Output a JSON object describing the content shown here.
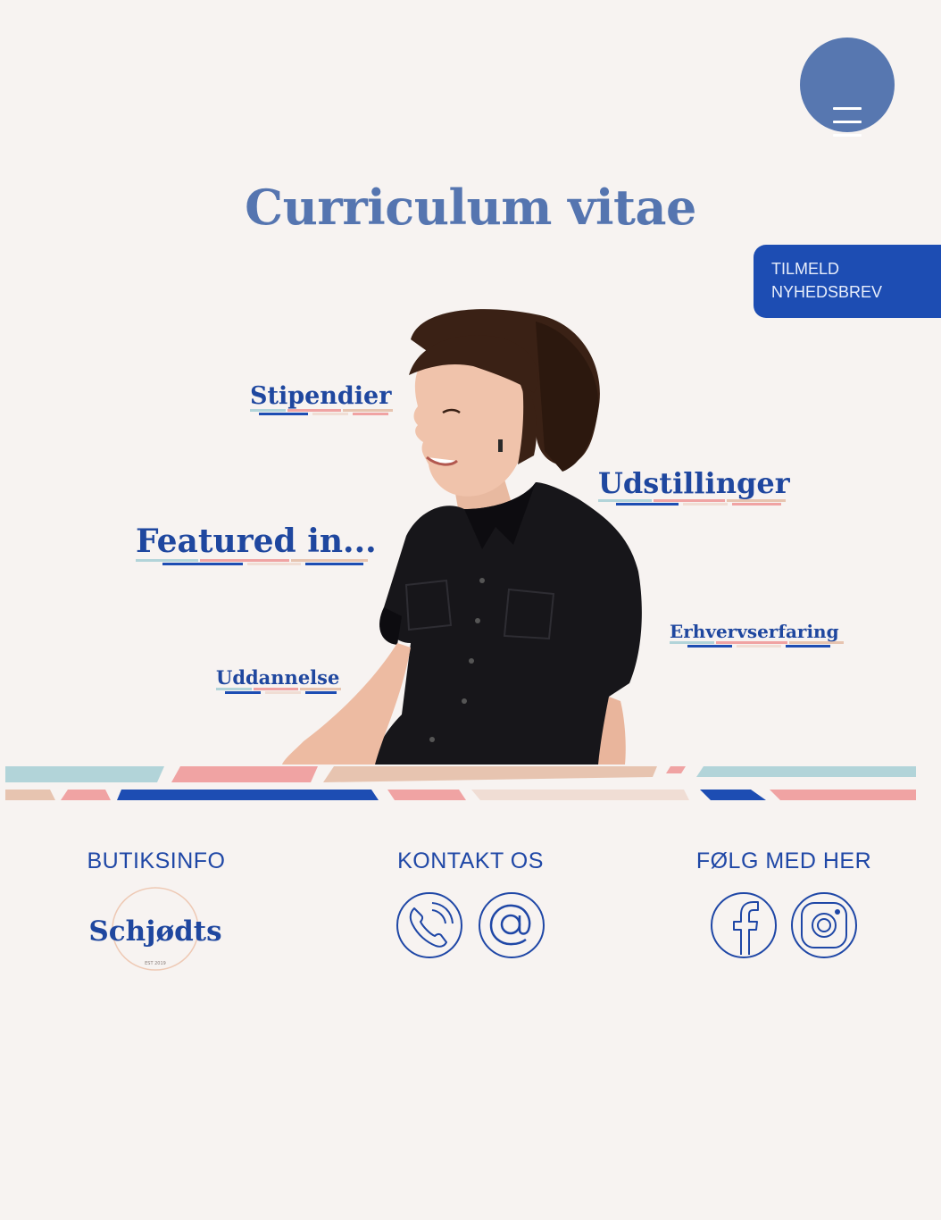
{
  "header": {
    "menu_icon": "hamburger-menu-icon",
    "title": "Curriculum vitae",
    "newsletter": {
      "line1": "TILMELD",
      "line2": "NYHEDSBREV"
    }
  },
  "hero": {
    "image": "portrait-photo",
    "links": {
      "stipendier": "Stipendier",
      "udstillinger": "Udstillinger",
      "featured": "Featured in...",
      "erhvervserfaring": "Erhvervserfaring",
      "uddannelse": "Uddannelse"
    }
  },
  "footer": {
    "butiksinfo": {
      "title": "BUTIKSINFO",
      "logo_text": "Schjødts",
      "logo_sub": "EST 2019"
    },
    "kontakt": {
      "title": "KONTAKT OS",
      "icons": [
        "phone-icon",
        "at-sign-icon"
      ]
    },
    "folg": {
      "title": "FØLG MED HER",
      "icons": [
        "facebook-icon",
        "instagram-icon"
      ]
    }
  },
  "colors": {
    "title_blue": "#5575b0",
    "link_blue": "#1f479f",
    "button_blue": "#1d4db3",
    "menu_blue": "#5777b0",
    "stripe_teal": "#b2d4d9",
    "stripe_pink": "#f0a3a3",
    "stripe_sand": "#e7c4b0",
    "stripe_cream": "#f0ddd4",
    "background": "#f7f3f1"
  }
}
